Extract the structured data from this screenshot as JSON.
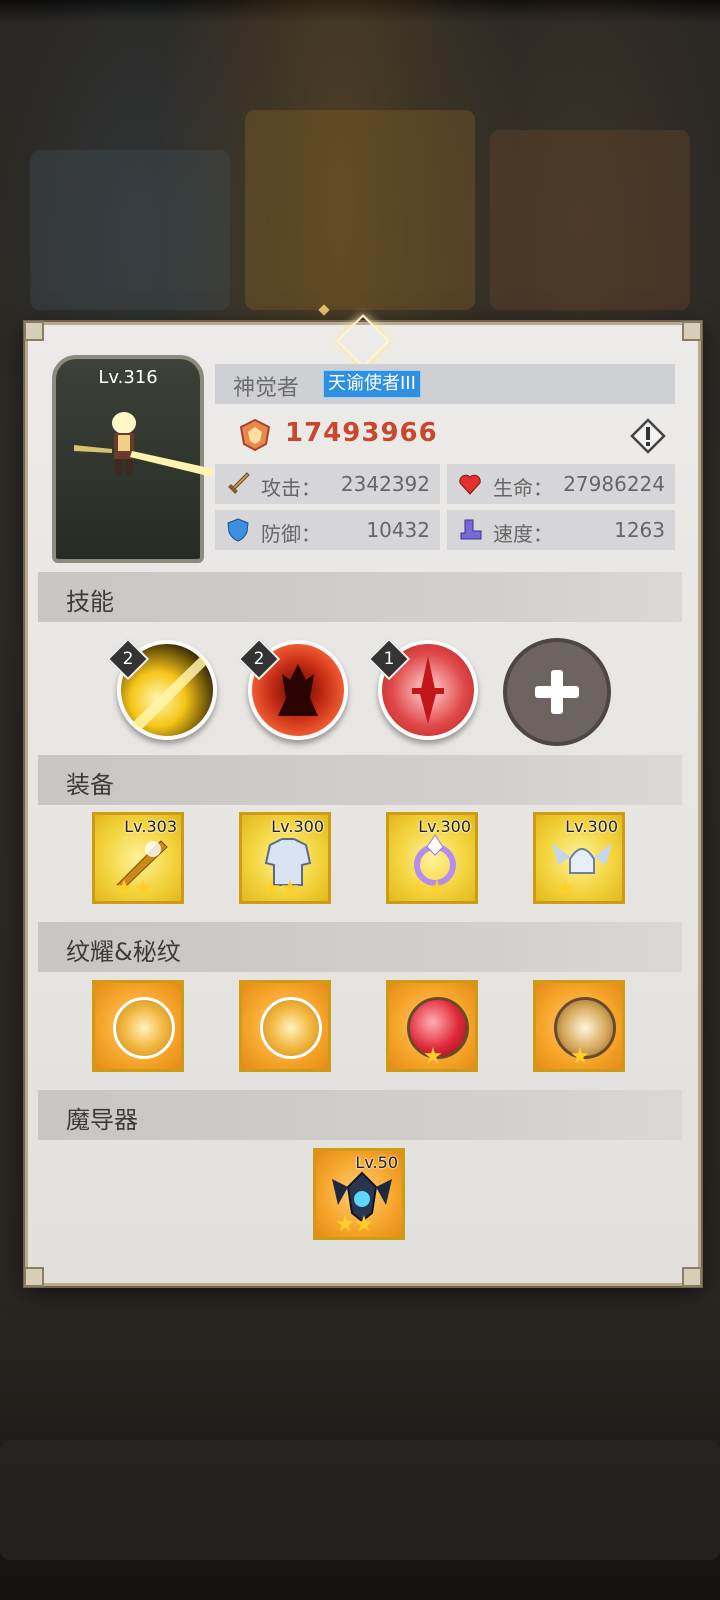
{
  "hero": {
    "level": "Lv.316",
    "name": "神觉者",
    "title": "天谕使者III",
    "power": "17493966"
  },
  "stats": [
    {
      "label": "攻击：",
      "value": "2342392",
      "icon": "sword-icon"
    },
    {
      "label": "生命：",
      "value": "27986224",
      "icon": "heart-icon"
    },
    {
      "label": "防御：",
      "value": "10432",
      "icon": "shield-icon"
    },
    {
      "label": "速度：",
      "value": "1263",
      "icon": "boot-icon"
    }
  ],
  "sections": {
    "skills": "技能",
    "equipment": "装备",
    "emblems": "纹耀&秘纹",
    "magic_device": "魔导器"
  },
  "skills": [
    {
      "level": "2",
      "icon": "light-slash-skill-icon"
    },
    {
      "level": "2",
      "icon": "demon-flame-skill-icon"
    },
    {
      "level": "1",
      "icon": "crimson-sword-skill-icon"
    }
  ],
  "equipment": [
    {
      "level": "Lv.303",
      "stars": 2,
      "icon": "golden-weapon-icon"
    },
    {
      "level": "Lv.300",
      "stars": 2,
      "icon": "silver-armor-icon"
    },
    {
      "level": "Lv.300",
      "stars": 2,
      "icon": "crystal-ring-icon"
    },
    {
      "level": "Lv.300",
      "stars": 1,
      "icon": "winged-helmet-icon"
    }
  ],
  "emblems": [
    {
      "stars": 0,
      "icon": "golden-swirl-emblem-icon"
    },
    {
      "stars": 0,
      "icon": "golden-swirl-emblem-icon"
    },
    {
      "stars": 1,
      "icon": "red-orb-rune-icon"
    },
    {
      "stars": 1,
      "icon": "flame-rune-icon"
    }
  ],
  "magic_device": {
    "level": "Lv.50",
    "stars": 2,
    "icon": "dark-dragon-device-icon"
  },
  "colors": {
    "power_red": "#c8482c",
    "title_blue": "#2f8fe0",
    "item_gold": "#f3d540",
    "item_orange": "#f6a52a"
  }
}
